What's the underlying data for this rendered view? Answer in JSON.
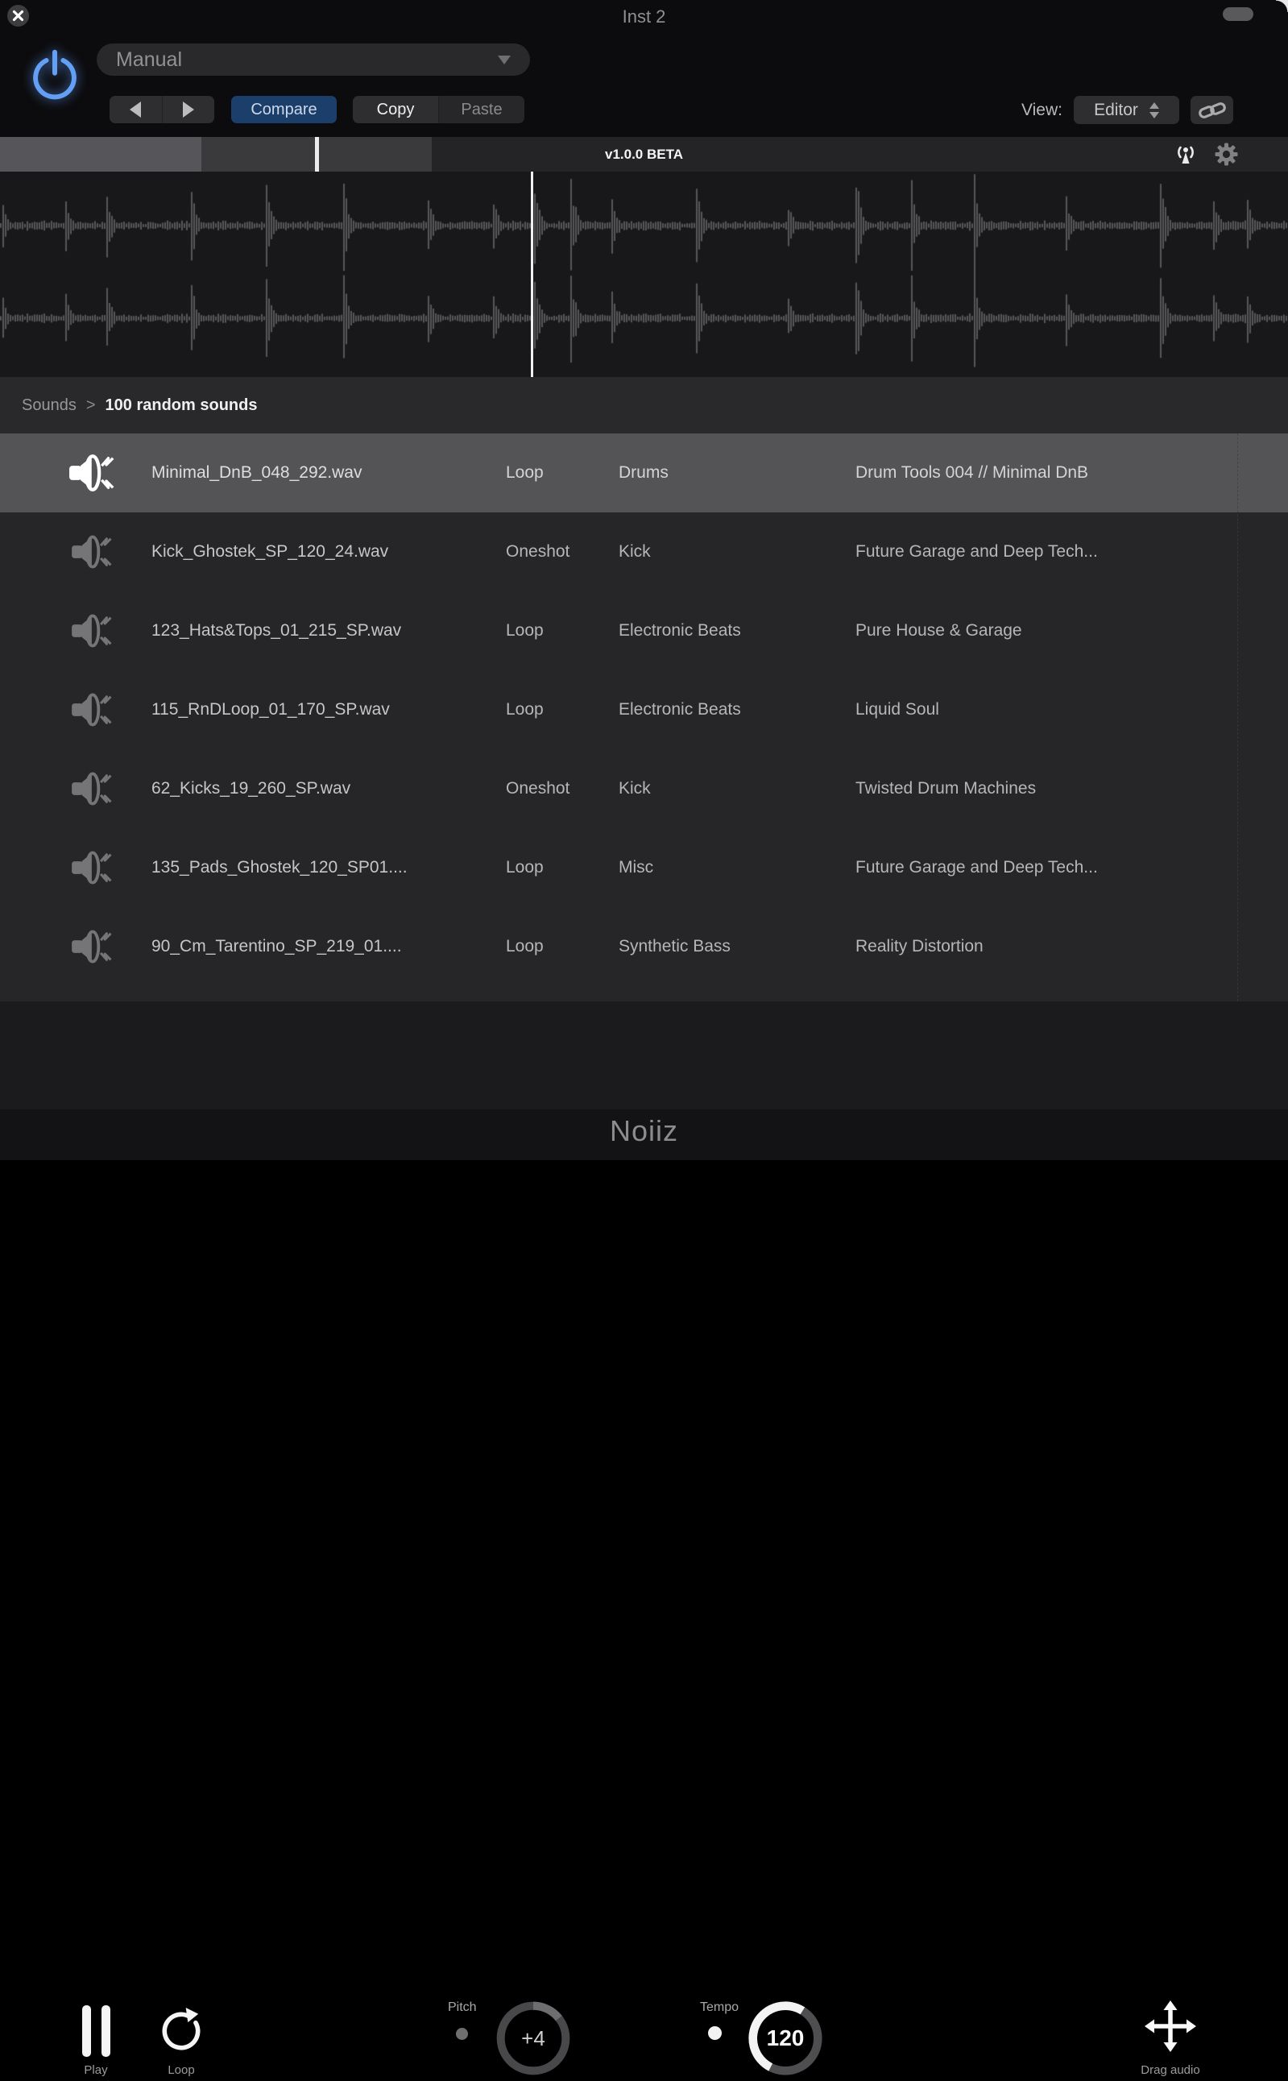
{
  "window": {
    "title": "Inst 2"
  },
  "header": {
    "preset_value": "Manual",
    "compare": "Compare",
    "copy": "Copy",
    "paste": "Paste",
    "view_label": "View:",
    "view_value": "Editor"
  },
  "version_bar": {
    "version_text": "v1.0.0 BETA"
  },
  "breadcrumb": {
    "root": "Sounds",
    "separator": ">",
    "current": "100 random sounds"
  },
  "sound_list": {
    "rows": [
      {
        "file": "Minimal_DnB_048_292.wav",
        "type": "Loop",
        "category": "Drums",
        "pack": "Drum Tools 004 // Minimal DnB",
        "selected": true
      },
      {
        "file": "Kick_Ghostek_SP_120_24.wav",
        "type": "Oneshot",
        "category": "Kick",
        "pack": "Future Garage and Deep Tech..."
      },
      {
        "file": "123_Hats&Tops_01_215_SP.wav",
        "type": "Loop",
        "category": "Electronic Beats",
        "pack": "Pure House & Garage"
      },
      {
        "file": "115_RnDLoop_01_170_SP.wav",
        "type": "Loop",
        "category": "Electronic Beats",
        "pack": "Liquid Soul"
      },
      {
        "file": "62_Kicks_19_260_SP.wav",
        "type": "Oneshot",
        "category": "Kick",
        "pack": "Twisted Drum Machines"
      },
      {
        "file": "135_Pads_Ghostek_120_SP01....",
        "type": "Loop",
        "category": "Misc",
        "pack": "Future Garage and Deep Tech..."
      },
      {
        "file": "90_Cm_Tarentino_SP_219_01....",
        "type": "Loop",
        "category": "Synthetic Bass",
        "pack": "Reality Distortion"
      }
    ]
  },
  "transport": {
    "play_label": "Play",
    "loop_label": "Loop",
    "pitch_label": "Pitch",
    "pitch_value": "+4",
    "tempo_label": "Tempo",
    "tempo_value": "120",
    "drag_label": "Drag audio"
  },
  "footer": {
    "brand": "Noiiz"
  },
  "icons": {
    "close": "close-icon",
    "power": "power-icon",
    "preset_caret": "chevron-down-icon",
    "prev": "arrow-left-icon",
    "next": "arrow-right-icon",
    "view_stepper": "up-down-stepper-icon",
    "link": "link-icon",
    "broadcast": "broadcast-icon",
    "settings": "gear-icon",
    "speaker": "speaker-icon",
    "play": "pause-icon",
    "loop": "loop-arrow-icon",
    "drag": "move-arrows-icon"
  },
  "colors": {
    "compare_blue": "#1c3e6b",
    "power_blue": "#63a0f5",
    "selected_row": "#545457",
    "waveform_bar": "#57575a",
    "knob_arc_white": "#f3f3f3",
    "pitch_arc": "#6e6e71"
  },
  "waveform": {
    "seed": 12,
    "playhead_fraction": 0.413,
    "minimap_marker_fraction": 0.245
  }
}
